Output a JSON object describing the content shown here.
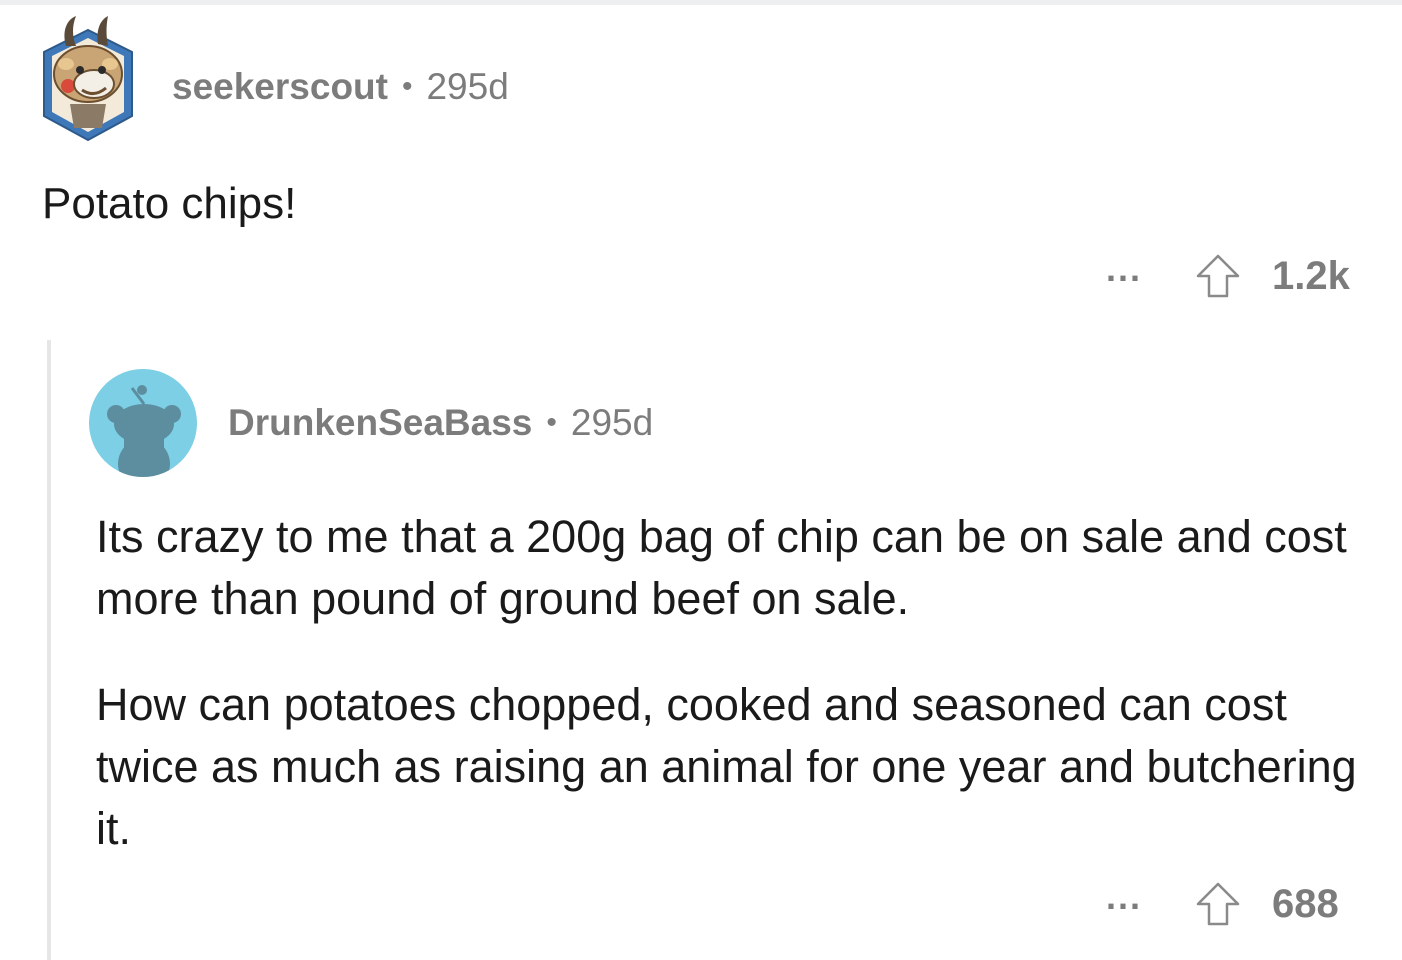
{
  "colors": {
    "meta_text": "#7c7c7c",
    "body_text": "#1a1a1b",
    "thread_line": "#e6e6e6",
    "snoo_avatar_bg": "#7ccfe4"
  },
  "comments": [
    {
      "username": "seekerscout",
      "separator": "•",
      "age": "295d",
      "avatar_icon": "antelope-avatar-icon",
      "body": [
        "Potato chips!"
      ],
      "more_label": "...",
      "upvote_icon": "upvote-arrow-icon",
      "score": "1.2k"
    },
    {
      "username": "DrunkenSeaBass",
      "separator": "•",
      "age": "295d",
      "avatar_icon": "snoo-avatar-icon",
      "body": [
        "Its crazy to me that a 200g bag of chip can be on sale and cost more than  pound of ground beef on sale.",
        "How can potatoes chopped, cooked and seasoned can cost twice as much as raising an animal for one year and butchering it."
      ],
      "more_label": "...",
      "upvote_icon": "upvote-arrow-icon",
      "score": "688"
    }
  ]
}
